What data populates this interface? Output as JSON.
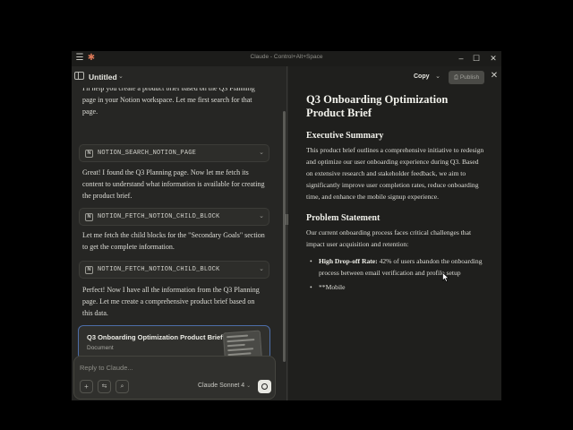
{
  "window": {
    "title": "Claude - Control+Alt+Space",
    "menu_icon": "hamburger-menu-icon",
    "logo_icon": "claude-logo-icon"
  },
  "chat": {
    "title": "Untitled",
    "messages": [
      {
        "type": "text",
        "text": "I'll help you create a product brief based on the Q3 Planning page in your Notion workspace. Let me first search for that page."
      },
      {
        "type": "tool",
        "label": "NOTION_SEARCH_NOTION_PAGE"
      },
      {
        "type": "text",
        "text": "Great! I found the Q3 Planning page. Now let me fetch its content to understand what information is available for creating the product brief."
      },
      {
        "type": "tool",
        "label": "NOTION_FETCH_NOTION_CHILD_BLOCK"
      },
      {
        "type": "text",
        "text": "Let me fetch the child blocks for the \"Secondary Goals\" section to get the complete information."
      },
      {
        "type": "tool",
        "label": "NOTION_FETCH_NOTION_CHILD_BLOCK"
      },
      {
        "type": "text",
        "text": "Perfect! Now I have all the information from the Q3 Planning page. Let me create a comprehensive product brief based on this data."
      }
    ],
    "tool_icon_letter": "N",
    "artifact": {
      "title": "Q3 Onboarding Optimization Product Brief",
      "type": "Document"
    },
    "composer": {
      "placeholder": "Reply to Claude...",
      "model": "Claude Sonnet 4"
    }
  },
  "doc": {
    "toolbar": {
      "copy_label": "Copy",
      "publish_label": "Publish"
    },
    "title": "Q3 Onboarding Optimization Product Brief",
    "sections": [
      {
        "heading": "Executive Summary",
        "paragraph": "This product brief outlines a comprehensive initiative to redesign and optimize our user onboarding experience during Q3. Based on extensive research and stakeholder feedback, we aim to significantly improve user completion rates, reduce onboarding time, and enhance the mobile signup experience."
      },
      {
        "heading": "Problem Statement",
        "paragraph": "Our current onboarding process faces critical challenges that impact user acquisition and retention:"
      }
    ],
    "bullets": [
      {
        "bold": "High Drop-off Rate:",
        "text": " 42% of users abandon the onboarding process between email verification and profile setup"
      },
      {
        "bold": "",
        "text": "**Mobile"
      }
    ]
  }
}
